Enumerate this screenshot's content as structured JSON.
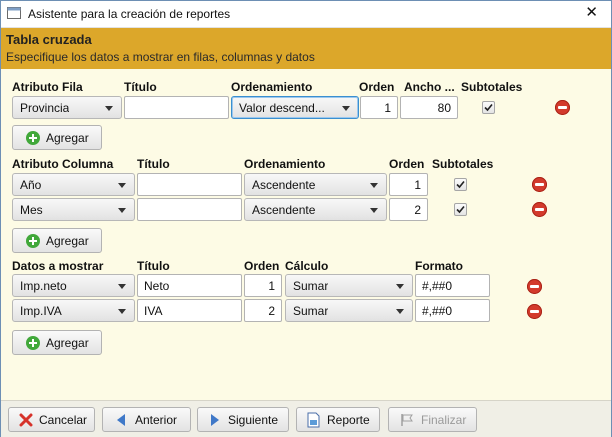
{
  "window": {
    "title": "Asistente para la creación de reportes",
    "close_symbol": "✕"
  },
  "banner": {
    "title": "Tabla cruzada",
    "subtitle": "Especifique los datos a mostrar en filas, columnas y datos"
  },
  "rows_section": {
    "headers": {
      "attribute": "Atributo Fila",
      "title": "Título",
      "ordering": "Ordenamiento",
      "order": "Orden",
      "width": "Ancho ...",
      "subtotals": "Subtotales"
    },
    "rows": [
      {
        "attribute": "Provincia",
        "title": "",
        "ordering": "Valor descend...",
        "order": "1",
        "width": "80",
        "subtotals": true
      }
    ],
    "add_label": "Agregar"
  },
  "columns_section": {
    "headers": {
      "attribute": "Atributo Columna",
      "title": "Título",
      "ordering": "Ordenamiento",
      "order": "Orden",
      "subtotals": "Subtotales"
    },
    "rows": [
      {
        "attribute": "Año",
        "title": "",
        "ordering": "Ascendente",
        "order": "1",
        "subtotals": true
      },
      {
        "attribute": "Mes",
        "title": "",
        "ordering": "Ascendente",
        "order": "2",
        "subtotals": true
      }
    ],
    "add_label": "Agregar"
  },
  "data_section": {
    "headers": {
      "data": "Datos a mostrar",
      "title": "Título",
      "order": "Orden",
      "calc": "Cálculo",
      "format": "Formato"
    },
    "rows": [
      {
        "data": "Imp.neto",
        "title": "Neto",
        "order": "1",
        "calc": "Sumar",
        "format": "#,##0"
      },
      {
        "data": "Imp.IVA",
        "title": "IVA",
        "order": "2",
        "calc": "Sumar",
        "format": "#,##0"
      }
    ],
    "add_label": "Agregar"
  },
  "footer": {
    "cancel": "Cancelar",
    "previous": "Anterior",
    "next": "Siguiente",
    "report": "Reporte",
    "finish": "Finalizar"
  },
  "colors": {
    "banner": "#dca72a",
    "panel": "#fdfbe5",
    "remove": "#d33a2c",
    "add": "#41a83a",
    "focus": "#3a8fd0"
  }
}
